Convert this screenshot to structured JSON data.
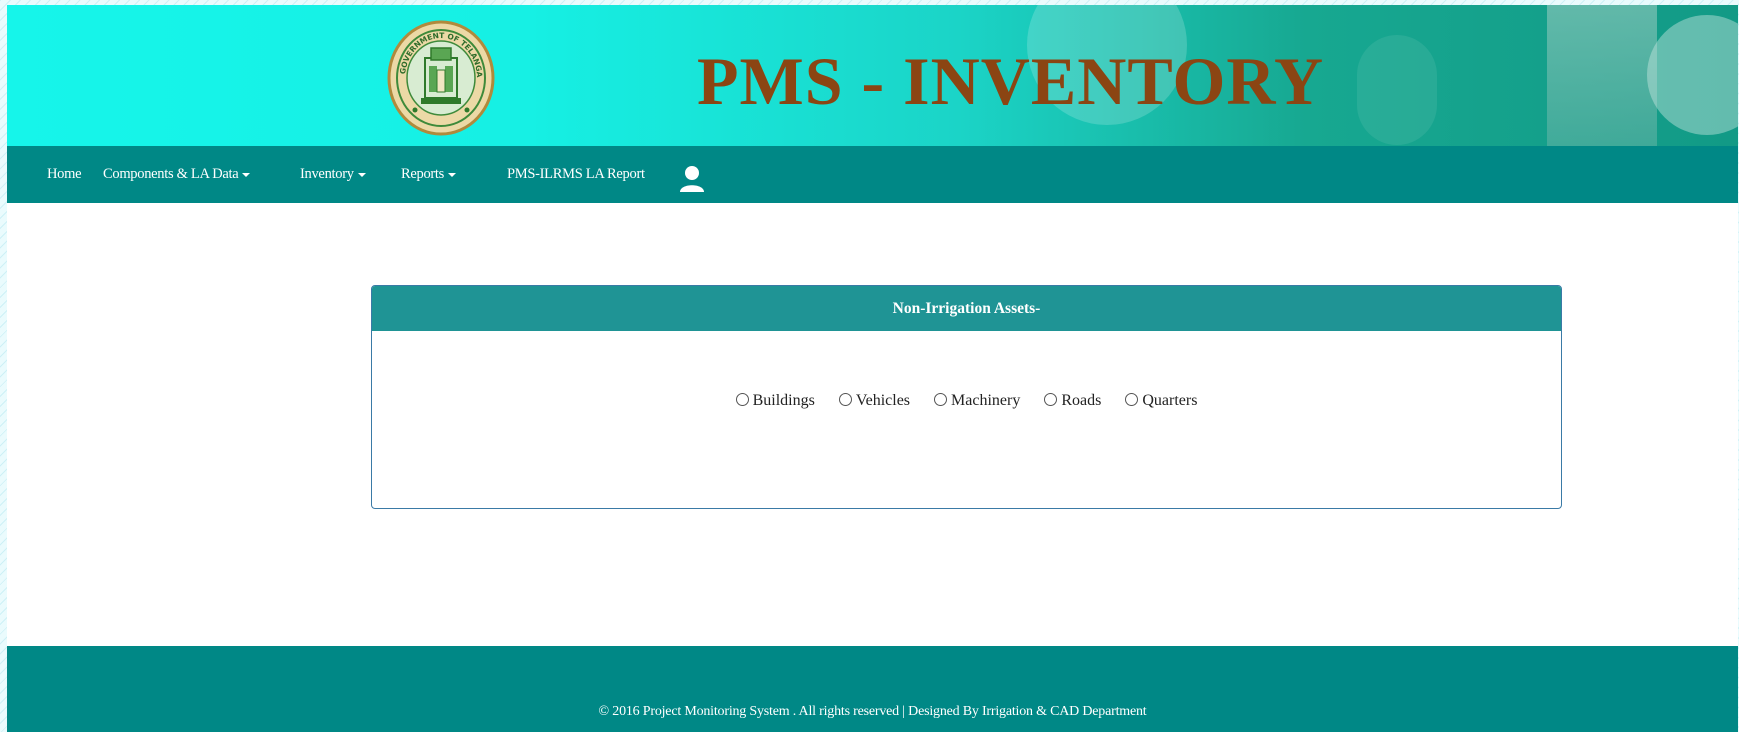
{
  "header": {
    "emblem_icon": "government-of-telangana-emblem",
    "emblem_text": "GOVERNMENT OF TELANGANA",
    "title": "PMS - INVENTORY",
    "title_color": "#8b4513"
  },
  "navbar": {
    "background": "#008886",
    "items": [
      {
        "label": "Home",
        "dropdown": false
      },
      {
        "label": "Components & LA Data",
        "dropdown": true
      },
      {
        "label": "Inventory",
        "dropdown": true
      },
      {
        "label": "Reports",
        "dropdown": true
      },
      {
        "label": "PMS-ILRMS LA Report",
        "dropdown": false
      }
    ],
    "user_icon": "user-icon"
  },
  "panel": {
    "heading": "Non-Irrigation Assets-",
    "options": [
      {
        "label": "Buildings",
        "checked": false
      },
      {
        "label": "Vehicles",
        "checked": false
      },
      {
        "label": "Machinery",
        "checked": false
      },
      {
        "label": "Roads",
        "checked": false
      },
      {
        "label": "Quarters",
        "checked": false
      }
    ]
  },
  "footer": {
    "text": "© 2016 Project Monitoring System . All rights reserved | Designed By Irrigation & CAD Department"
  }
}
